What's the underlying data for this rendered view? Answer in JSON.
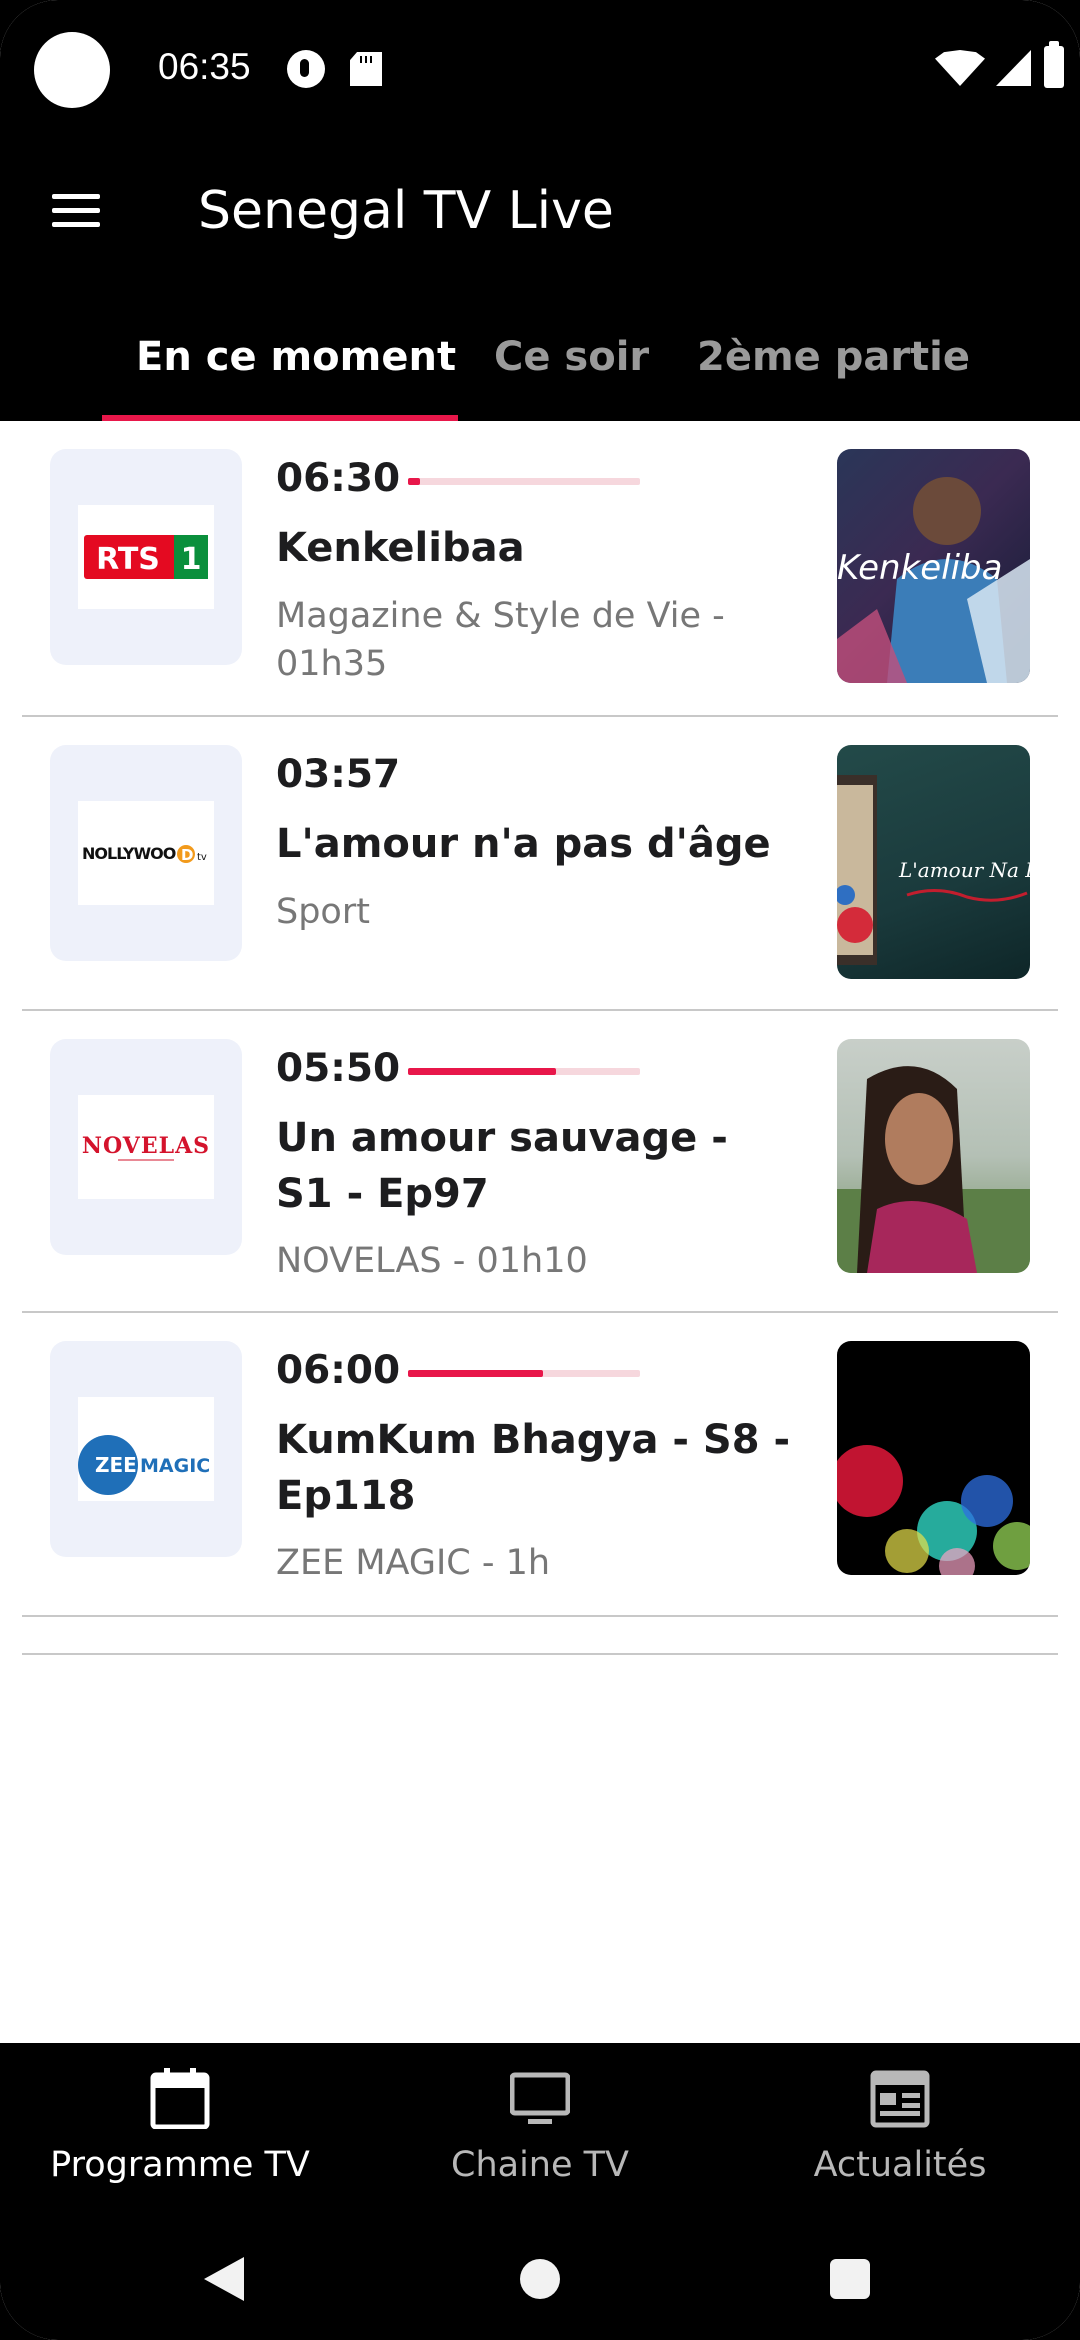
{
  "status_bar": {
    "time": "06:35",
    "icons": [
      "camera-cutout",
      "vpn-icon",
      "sd-card-icon",
      "wifi-icon",
      "signal-icon",
      "battery-icon"
    ]
  },
  "app_bar": {
    "title": "Senegal TV Live",
    "menu_icon": "menu-icon"
  },
  "tabs": [
    {
      "label": "En ce moment",
      "active": true
    },
    {
      "label": "Ce soir",
      "active": false
    },
    {
      "label": "2ème partie",
      "active": false
    }
  ],
  "programs": [
    {
      "channel_logo": "RTS1",
      "time": "06:30",
      "progress": 0.05,
      "title": "Kenkelibaa",
      "meta": "Magazine & Style de Vie - 01h35",
      "thumbnail_text": "Kenkeliba"
    },
    {
      "channel_logo": "NOLLYWOOD tv",
      "time": "03:57",
      "progress": null,
      "title": "L'amour n'a pas d'âge",
      "meta": "Sport",
      "thumbnail_text": "L'amour Na P"
    },
    {
      "channel_logo": "NOVELAS",
      "time": "05:50",
      "progress": 0.64,
      "title": "Un amour sauvage - S1 - Ep97",
      "meta": "NOVELAS - 01h10",
      "thumbnail_text": ""
    },
    {
      "channel_logo": "ZEEMAGIC",
      "time": "06:00",
      "progress": 0.58,
      "title": "KumKum Bhagya - S8 - Ep118",
      "meta": "ZEE MAGIC - 1h",
      "thumbnail_text": ""
    }
  ],
  "bottom_nav": [
    {
      "label": "Programme TV",
      "icon": "calendar-icon",
      "active": true
    },
    {
      "label": "Chaine TV",
      "icon": "tv-icon",
      "active": false
    },
    {
      "label": "Actualités",
      "icon": "news-icon",
      "active": false
    }
  ],
  "colors": {
    "accent": "#e8174a",
    "bar_background": "#000000",
    "card_background": "#eef1fa",
    "progress_track": "#f6d7dd"
  }
}
